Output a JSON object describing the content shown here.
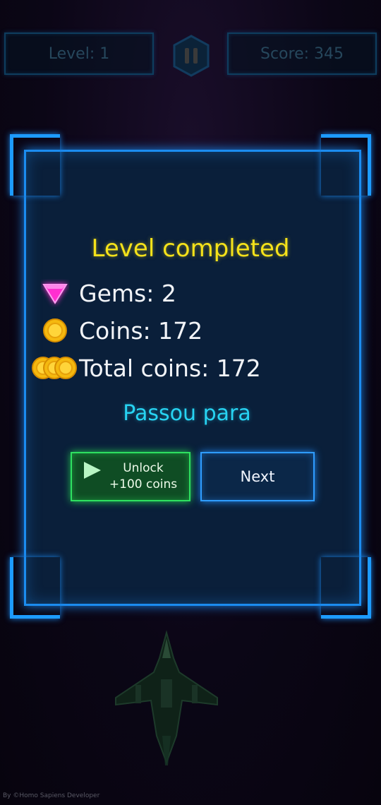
{
  "hud": {
    "level_label": "Level: 1",
    "score_label": "Score: 345"
  },
  "dialog": {
    "title": "Level completed",
    "gems_label": "Gems: 2",
    "coins_label": "Coins: 172",
    "total_coins_label": "Total coins: 172",
    "subtitle": "Passou para",
    "unlock_line1": "Unlock",
    "unlock_line2": "+100 coins",
    "next_label": "Next"
  },
  "icons": {
    "gem": "gem-icon",
    "coin": "coin-icon",
    "coins": "coin-stack-icon",
    "pause": "pause-icon",
    "play": "play-icon"
  },
  "colors": {
    "title": "#f5e21a",
    "subtitle": "#27d3f2",
    "panel_border": "#1b8cf0",
    "unlock_border": "#2ee060",
    "next_border": "#2f9cff"
  },
  "footer": {
    "credit": "By ©Homo Sapiens Developer"
  }
}
